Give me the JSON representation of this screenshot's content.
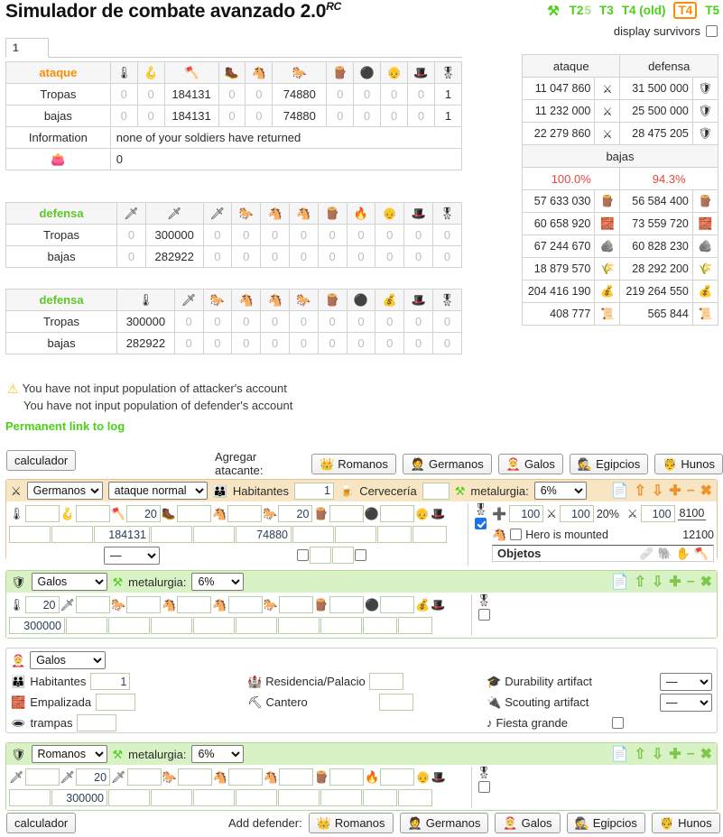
{
  "header": {
    "title": "Simulador de combate avanzado 2.0",
    "title_sup": "RC",
    "anvil_icon": "anvil-icon",
    "versions": [
      {
        "label": "T2",
        "state": "link"
      },
      {
        "label": "5",
        "state": "dim"
      },
      {
        "label": "T3",
        "state": "link"
      },
      {
        "label": "T4 (old)",
        "state": "link"
      },
      {
        "label": "T4",
        "state": "current"
      },
      {
        "label": "T5",
        "state": "link"
      }
    ],
    "display_survivors_label": "display survivors",
    "display_survivors_checked": false
  },
  "tabs": [
    {
      "label": "1",
      "active": true
    }
  ],
  "attack_report": {
    "header_label": "ataque",
    "unit_icons": [
      "club-icon",
      "spear-icon",
      "axe-icon",
      "scout-boot-icon",
      "horse-light-icon",
      "horse-dark-icon",
      "ram-icon",
      "catapult-icon",
      "chief-icon",
      "settler-icon",
      "hero-icon"
    ],
    "rows": [
      {
        "label": "Tropas",
        "values": [
          "0",
          "0",
          "184131",
          "0",
          "0",
          "74880",
          "0",
          "0",
          "0",
          "0",
          "1"
        ]
      },
      {
        "label": "bajas",
        "values": [
          "0",
          "0",
          "184131",
          "0",
          "0",
          "74880",
          "0",
          "0",
          "0",
          "0",
          "1"
        ]
      }
    ],
    "information_label": "Information",
    "information_value": "none of your soldiers have returned",
    "bounty_icon": "bounty-bag-icon",
    "bounty_value": "0"
  },
  "defense_report_1": {
    "header_label": "defensa",
    "unit_icons": [
      "phalanx-icon",
      "swordsman-icon",
      "pathfinder-icon",
      "horse-grey-icon",
      "horse-tan-icon",
      "horse-gold-icon",
      "ram-gaul-icon",
      "catapult-fire-icon",
      "chief-gaul-icon",
      "settler-gaul-icon",
      "hero-icon"
    ],
    "rows": [
      {
        "label": "Tropas",
        "values": [
          "0",
          "300000",
          "0",
          "0",
          "0",
          "0",
          "0",
          "0",
          "0",
          "0",
          "0"
        ]
      },
      {
        "label": "bajas",
        "values": [
          "0",
          "282922",
          "0",
          "0",
          "0",
          "0",
          "0",
          "0",
          "0",
          "0",
          "0"
        ]
      }
    ]
  },
  "defense_report_2": {
    "header_label": "defensa",
    "unit_icons": [
      "clubswinger-icon",
      "sword-blue-icon",
      "horse-grey-icon",
      "horse-tan-icon",
      "horse-brown-icon",
      "horse-dark-icon",
      "ram-icon",
      "catapult-grey-icon",
      "chief-icon",
      "settler-red-icon",
      "hero-icon"
    ],
    "rows": [
      {
        "label": "Tropas",
        "values": [
          "300000",
          "0",
          "0",
          "0",
          "0",
          "0",
          "0",
          "0",
          "0",
          "0",
          "0"
        ]
      },
      {
        "label": "bajas",
        "values": [
          "282922",
          "0",
          "0",
          "0",
          "0",
          "0",
          "0",
          "0",
          "0",
          "0",
          "0"
        ]
      }
    ]
  },
  "summary": {
    "col_headers": [
      "ataque",
      "defensa"
    ],
    "rows": [
      {
        "attack": "11 047 860",
        "attack_icon": "swords-infantry-icon",
        "defense": "31 500 000",
        "defense_icon": "shield-germanic-icon"
      },
      {
        "attack": "11 232 000",
        "attack_icon": "swords-cavalry-icon",
        "defense": "25 500 000",
        "defense_icon": "shield-gaul-icon"
      },
      {
        "attack": "22 279 860",
        "attack_icon": "swords-total-icon",
        "defense": "28 475 205",
        "defense_icon": "shield-roman-icon"
      }
    ],
    "bajas_label": "bajas",
    "bajas_attack_pct": "100.0%",
    "bajas_defense_pct": "94.3%",
    "resource_rows": [
      {
        "attack": "57 633 030",
        "defense": "56 584 400",
        "icon": "wood-icon"
      },
      {
        "attack": "60 658 920",
        "defense": "73 559 720",
        "icon": "clay-icon"
      },
      {
        "attack": "67 244 670",
        "defense": "60 828 230",
        "icon": "iron-icon"
      },
      {
        "attack": "18 879 570",
        "defense": "28 292 200",
        "icon": "crop-icon"
      },
      {
        "attack": "204 416 190",
        "defense": "219 264 550",
        "icon": "resources-total-icon"
      },
      {
        "attack": "408 777",
        "defense": "565 844",
        "icon": "culture-points-icon"
      }
    ]
  },
  "warnings": {
    "icon": "warning-triangle-icon",
    "lines": [
      "You have not input population of attacker's account",
      "You have not input population of defender's account"
    ],
    "permanent_link_label": "Permanent link to log"
  },
  "toolbar_top": {
    "calculator_label": "calculador",
    "add_label": "Agregar atacante:",
    "tribes": [
      {
        "label": "Romanos",
        "icon": "roman-head-icon"
      },
      {
        "label": "Germanos",
        "icon": "germanic-head-icon"
      },
      {
        "label": "Galos",
        "icon": "gaul-head-icon"
      },
      {
        "label": "Egipcios",
        "icon": "egyptian-head-icon"
      },
      {
        "label": "Hunos",
        "icon": "hun-head-icon"
      }
    ]
  },
  "toolbar_bottom": {
    "calculator_label": "calculador",
    "add_label": "Add defender:",
    "tribes": [
      {
        "label": "Romanos",
        "icon": "roman-head-icon"
      },
      {
        "label": "Germanos",
        "icon": "germanic-head-icon"
      },
      {
        "label": "Galos",
        "icon": "gaul-head-icon"
      },
      {
        "label": "Egipcios",
        "icon": "egyptian-head-icon"
      },
      {
        "label": "Hunos",
        "icon": "hun-head-icon"
      }
    ]
  },
  "attacker_panel": {
    "side_icon": "swords-icon",
    "tribe": "Germanos",
    "tribe_options": [
      "Romanos",
      "Germanos",
      "Galos",
      "Egipcios",
      "Hunos"
    ],
    "attack_type": "ataque normal",
    "attack_type_options": [
      "ataque normal",
      "asalto"
    ],
    "population_icon": "population-icon",
    "population_label": "Habitantes",
    "population_value": "1",
    "brewery_icon": "brewery-icon",
    "brewery_label": "Cervecería",
    "brewery_value": "",
    "metallurgy_icon": "anvil-icon",
    "metallurgy_label": "metalurgia:",
    "metallurgy_value": "6%",
    "metallurgy_options": [
      "0%",
      "3%",
      "6%",
      "9%"
    ],
    "controls": [
      "copy-icon",
      "move-up-icon",
      "move-down-icon",
      "add-icon",
      "minimize-icon",
      "close-icon"
    ],
    "unit_icons": [
      "club-icon",
      "spear-icon",
      "axe-icon",
      "scout-boot-icon",
      "horse-light-icon",
      "horse-dark-icon",
      "ram-icon",
      "catapult-icon",
      "chief-icon",
      "settler-icon"
    ],
    "levels": [
      "",
      "",
      "20",
      "",
      "",
      "20",
      "",
      "",
      "",
      ""
    ],
    "counts": [
      "",
      "",
      "184131",
      "",
      "",
      "74880",
      "",
      "",
      "",
      ""
    ],
    "catapult_target": "—",
    "catapult_target_options": [
      "—",
      "random",
      "residence"
    ],
    "hero_icon": "hero-icon",
    "hero_checked": true,
    "hero_health_icon": "hero-health-icon",
    "hero_health": "100",
    "hero_offbonus_icon": "hero-offbonus-icon",
    "hero_offbonus": "100",
    "hero_offbonus_pct": "20%",
    "hero_power_icon": "hero-power-icon",
    "hero_power": "100",
    "hero_attack_foot": "8100",
    "hero_attack_mounted": "12100",
    "hero_mounted_label": "Hero is mounted",
    "hero_mounted_checked": false,
    "hero_mounted_icon": "horse-hero-icon",
    "objetos_label": "Objetos",
    "objetos_icons": [
      "bandage-icon",
      "elephant-icon",
      "hand-icon",
      "axe-item-icon"
    ]
  },
  "defender_panel_1": {
    "side_icon": "shield-icon",
    "tribe": "Galos",
    "tribe_options": [
      "Romanos",
      "Germanos",
      "Galos",
      "Egipcios",
      "Hunos"
    ],
    "metallurgy_icon": "anvil-icon",
    "metallurgy_label": "metalurgia:",
    "metallurgy_value": "6%",
    "metallurgy_options": [
      "0%",
      "3%",
      "6%",
      "9%"
    ],
    "controls": [
      "copy-icon",
      "move-up-icon",
      "move-down-icon",
      "add-icon",
      "minimize-icon",
      "close-icon"
    ],
    "unit_icons": [
      "clubswinger-icon",
      "sword-blue-icon",
      "horse-grey-icon",
      "horse-tan-icon",
      "horse-brown-icon",
      "horse-dark-icon",
      "ram-icon",
      "catapult-grey-icon",
      "chief-icon",
      "settler-red-icon"
    ],
    "levels": [
      "20",
      "",
      "",
      "",
      "",
      "",
      "",
      "",
      "",
      ""
    ],
    "counts": [
      "300000",
      "",
      "",
      "",
      "",
      "",
      "",
      "",
      "",
      ""
    ],
    "hero_icon": "hero-icon",
    "hero_checked": false
  },
  "village_panel": {
    "tribe_icon": "gaul-head-icon",
    "tribe": "Galos",
    "tribe_options": [
      "Romanos",
      "Germanos",
      "Galos",
      "Egipcios",
      "Hunos"
    ],
    "fields_left": [
      {
        "icon": "population-icon",
        "label": "Habitantes",
        "value": "1"
      },
      {
        "icon": "palisade-icon",
        "label": "Empalizada",
        "value": ""
      },
      {
        "icon": "traps-icon",
        "label": "trampas",
        "value": ""
      }
    ],
    "fields_mid": [
      {
        "icon": "residence-icon",
        "label": "Residencia/Palacio",
        "value": ""
      },
      {
        "icon": "stonemason-icon",
        "label": "Cantero",
        "value": ""
      }
    ],
    "fields_right": [
      {
        "icon": "durability-artifact-icon",
        "label": "Durability artifact",
        "value": "—",
        "type": "select"
      },
      {
        "icon": "scouting-artifact-icon",
        "label": "Scouting artifact",
        "value": "—",
        "type": "select"
      },
      {
        "icon": "music-note-icon",
        "label": "Fiesta grande",
        "value": "",
        "type": "checkbox",
        "checked": false
      }
    ]
  },
  "defender_panel_2": {
    "side_icon": "shield-icon",
    "tribe": "Romanos",
    "tribe_options": [
      "Romanos",
      "Germanos",
      "Galos",
      "Egipcios",
      "Hunos"
    ],
    "metallurgy_icon": "anvil-icon",
    "metallurgy_label": "metalurgia:",
    "metallurgy_value": "6%",
    "metallurgy_options": [
      "0%",
      "3%",
      "6%",
      "9%"
    ],
    "controls": [
      "copy-icon",
      "move-up-icon",
      "move-down-icon",
      "add-icon",
      "minimize-icon",
      "close-icon"
    ],
    "unit_icons": [
      "phalanx-icon",
      "swordsman-icon",
      "pathfinder-icon",
      "horse-grey-icon",
      "horse-tan-icon",
      "horse-gold-icon",
      "ram-gaul-icon",
      "catapult-fire-icon",
      "chief-gaul-icon",
      "settler-gaul-icon"
    ],
    "levels": [
      "",
      "20",
      "",
      "",
      "",
      "",
      "",
      "",
      "",
      ""
    ],
    "counts": [
      "",
      "300000",
      "",
      "",
      "",
      "",
      "",
      "",
      "",
      ""
    ],
    "hero_icon": "hero-icon",
    "hero_checked": false
  },
  "colors": {
    "attack": "#ff8c00",
    "defense": "#5fc72a",
    "link_green": "#4ad017",
    "loss_red": "#e8453c",
    "panel_attack_bg": "#f7e5c3",
    "panel_defense_bg": "#d9f2c5"
  }
}
